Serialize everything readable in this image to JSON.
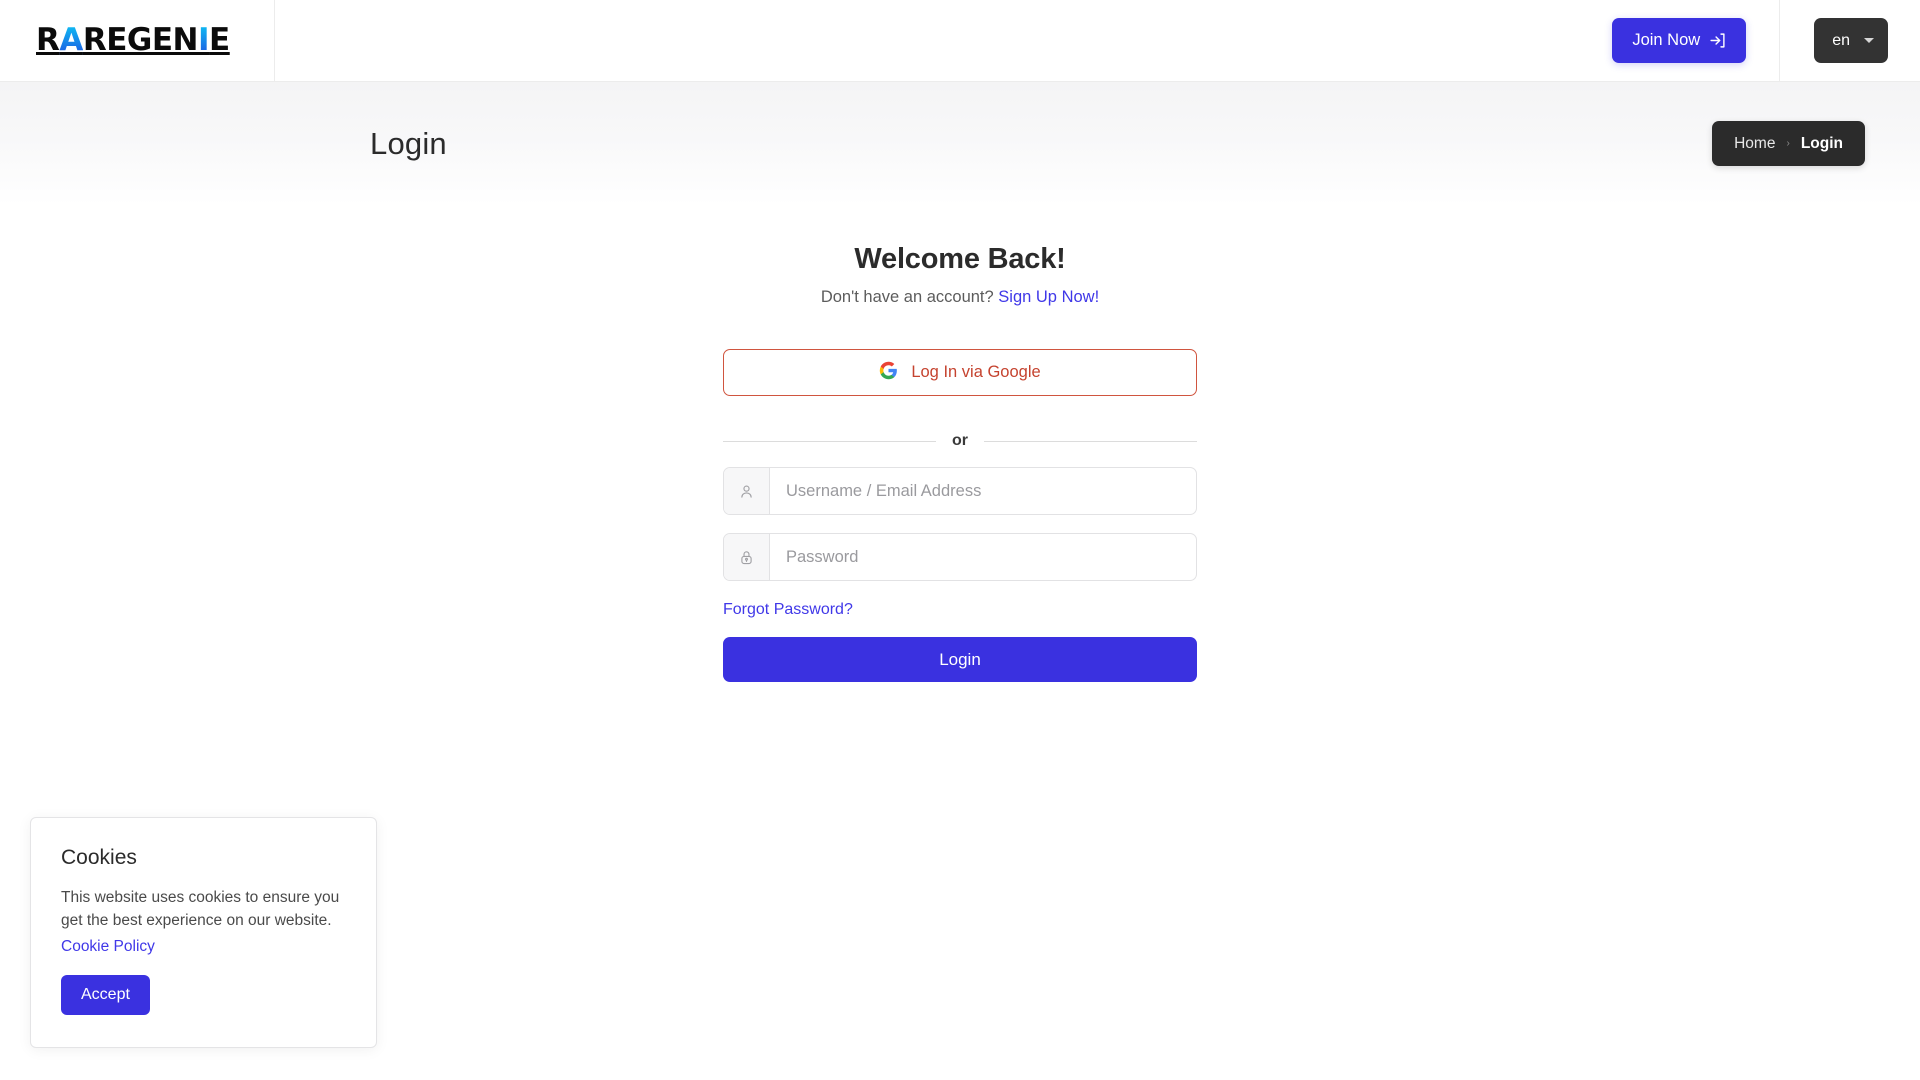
{
  "header": {
    "brand": {
      "prefix": "R",
      "accent1": "A",
      "mid": "REGEN",
      "accent2": "I",
      "suffix": "E",
      "full": "RAREGENIE"
    },
    "join_label": "Join Now",
    "join_icon": "sign-in-arrow-icon",
    "language": {
      "value": "en",
      "caret_icon": "chevron-down-icon"
    }
  },
  "hero": {
    "page_title": "Login",
    "breadcrumb": {
      "home": "Home",
      "separator": "›",
      "current": "Login"
    }
  },
  "form": {
    "welcome_title": "Welcome Back!",
    "signup_prompt": "Don't have an account?",
    "signup_link": "Sign Up Now!",
    "google_button": "Log In via Google",
    "google_icon": "google-g-icon",
    "divider_text": "or",
    "username": {
      "placeholder": "Username / Email Address",
      "value": "",
      "icon": "user-icon"
    },
    "password": {
      "placeholder": "Password",
      "value": "",
      "icon": "lock-icon"
    },
    "forgot_link": "Forgot Password?",
    "submit_label": "Login"
  },
  "cookies": {
    "title": "Cookies",
    "body": "This website uses cookies to ensure you get the best experience on our website.",
    "policy_link": "Cookie Policy",
    "accept_label": "Accept"
  },
  "colors": {
    "brand_indigo": "#3a31e0",
    "link_indigo": "#4038e8",
    "google_red": "#c5432f",
    "google_border": "#d0553f",
    "dark_pill": "#2b2b2b",
    "lang_dark": "#333333",
    "logo_gradient_from": "#0cc7f5",
    "logo_gradient_to": "#1f4fe0"
  }
}
